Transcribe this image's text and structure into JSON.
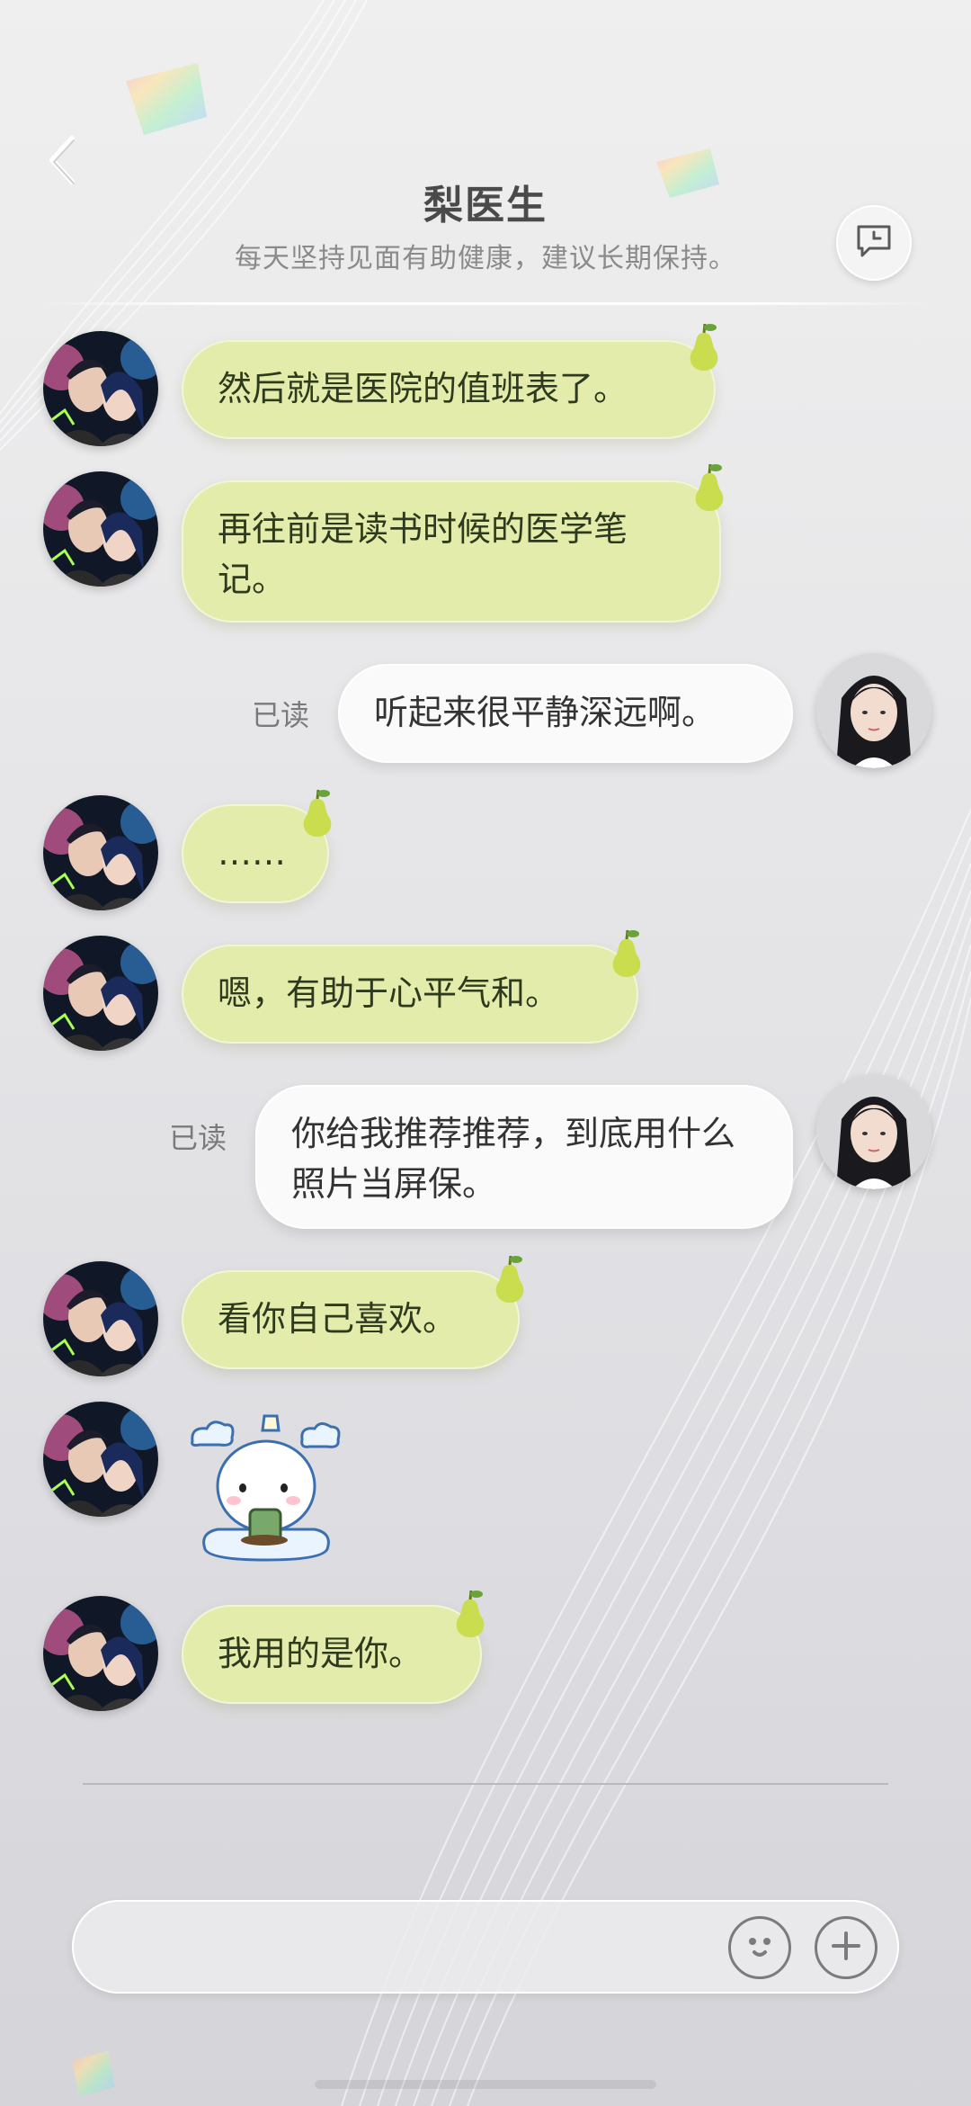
{
  "header": {
    "title": "梨医生",
    "subtitle": "每天坚持见面有助健康，建议长期保持。",
    "back_icon": "chevron-left-icon",
    "history_icon": "chat-history-icon"
  },
  "colors": {
    "bot_bubble": "#e4ecab",
    "user_bubble": "#fafafa",
    "pear_green": "#c9dd4e",
    "read_label": "#7a7a7a"
  },
  "messages": [
    {
      "sender": "bot",
      "text": "然后就是医院的值班表了。"
    },
    {
      "sender": "bot",
      "text": "再往前是读书时候的医学笔记。"
    },
    {
      "sender": "user",
      "text": "听起来很平静深远啊。",
      "status": "已读"
    },
    {
      "sender": "bot",
      "text": "……"
    },
    {
      "sender": "bot",
      "text": "嗯，有助于心平气和。"
    },
    {
      "sender": "user",
      "text": "你给我推荐推荐，到底用什么照片当屏保。",
      "status": "已读"
    },
    {
      "sender": "bot",
      "text": "看你自己喜欢。"
    },
    {
      "sender": "bot",
      "type": "sticker",
      "sticker_icon": "cloud-bear-drinking-tea-sticker"
    },
    {
      "sender": "bot",
      "text": "我用的是你。"
    }
  ],
  "composer": {
    "input_value": "",
    "emoji_icon": "smiley-face-icon",
    "plus_icon": "plus-icon"
  }
}
